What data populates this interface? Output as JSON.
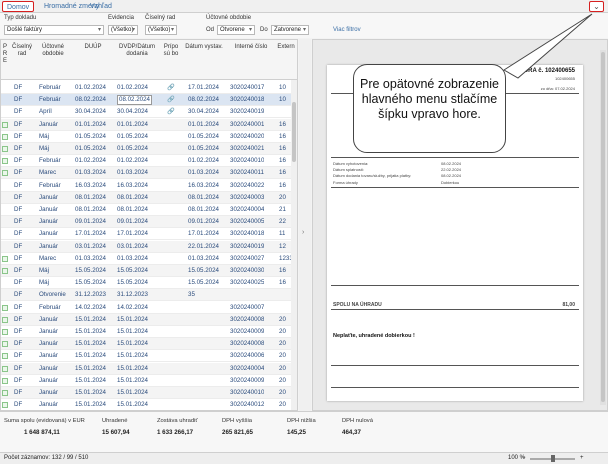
{
  "tabs": [
    "Domov",
    "Hromadné zmeny",
    "Vzhľad"
  ],
  "filters": {
    "typ_label": "Typ dokladu",
    "typ_value": "Došlé faktúry",
    "evidencia_label": "Evidencia",
    "evidencia_value": "(Všetko)",
    "ciselny_label": "Číselný rad",
    "ciselny_value": "(Všetko)",
    "uctovne_label": "Účtovné obdobie",
    "od_label": "Od",
    "od_value": "Otvorene",
    "do_label": "Do",
    "do_value": "Zatvorene",
    "more_link": "Viac filtrov"
  },
  "columns": [
    "P R E",
    "Číselný rad",
    "Účtovné obdobie",
    "DUÚP",
    "DVDP/Dátum dodania",
    "Prípo sú bo",
    "Dátum vystav.",
    "Interné číslo",
    "Extern"
  ],
  "rows": [
    {
      "cr": "DF",
      "ob": "Február",
      "duup": "01.02.2024",
      "dvdp": "01.02.2024",
      "att": "🔗",
      "dv": "17.01.2024",
      "ic": "3020240017",
      "ex": "10",
      "chk": false
    },
    {
      "cr": "DF",
      "ob": "Február",
      "duup": "08.02.2024",
      "dvdp": "08.02.2024",
      "att": "🔗",
      "dv": "08.02.2024",
      "ic": "3020240018",
      "ex": "10",
      "chk": false
    },
    {
      "cr": "DF",
      "ob": "Apríl",
      "duup": "30.04.2024",
      "dvdp": "30.04.2024",
      "att": "🔗",
      "dv": "30.04.2024",
      "ic": "3020240019",
      "ex": "",
      "chk": false
    },
    {
      "cr": "DF",
      "ob": "Január",
      "duup": "01.01.2024",
      "dvdp": "01.01.2024",
      "att": "",
      "dv": "01.01.2024",
      "ic": "3020240001",
      "ex": "16",
      "chk": true
    },
    {
      "cr": "DF",
      "ob": "Máj",
      "duup": "01.05.2024",
      "dvdp": "01.05.2024",
      "att": "",
      "dv": "01.05.2024",
      "ic": "3020240020",
      "ex": "16",
      "chk": true
    },
    {
      "cr": "DF",
      "ob": "Máj",
      "duup": "01.05.2024",
      "dvdp": "01.05.2024",
      "att": "",
      "dv": "01.05.2024",
      "ic": "3020240021",
      "ex": "16",
      "chk": true
    },
    {
      "cr": "DF",
      "ob": "Február",
      "duup": "01.02.2024",
      "dvdp": "01.02.2024",
      "att": "",
      "dv": "01.02.2024",
      "ic": "3020240010",
      "ex": "16",
      "chk": true
    },
    {
      "cr": "DF",
      "ob": "Marec",
      "duup": "01.03.2024",
      "dvdp": "01.03.2024",
      "att": "",
      "dv": "01.03.2024",
      "ic": "3020240011",
      "ex": "16",
      "chk": true
    },
    {
      "cr": "DF",
      "ob": "Február",
      "duup": "16.03.2024",
      "dvdp": "16.03.2024",
      "att": "",
      "dv": "16.03.2024",
      "ic": "3020240022",
      "ex": "16",
      "chk": false
    },
    {
      "cr": "DF",
      "ob": "Január",
      "duup": "08.01.2024",
      "dvdp": "08.01.2024",
      "att": "",
      "dv": "08.01.2024",
      "ic": "3020240003",
      "ex": "20",
      "chk": false
    },
    {
      "cr": "DF",
      "ob": "Január",
      "duup": "08.01.2024",
      "dvdp": "08.01.2024",
      "att": "",
      "dv": "08.01.2024",
      "ic": "3020240004",
      "ex": "21",
      "chk": false
    },
    {
      "cr": "DF",
      "ob": "Január",
      "duup": "09.01.2024",
      "dvdp": "09.01.2024",
      "att": "",
      "dv": "09.01.2024",
      "ic": "3020240005",
      "ex": "22",
      "chk": false
    },
    {
      "cr": "DF",
      "ob": "Január",
      "duup": "17.01.2024",
      "dvdp": "17.01.2024",
      "att": "",
      "dv": "17.01.2024",
      "ic": "3020240018",
      "ex": "11",
      "chk": false
    },
    {
      "cr": "DF",
      "ob": "Január",
      "duup": "03.01.2024",
      "dvdp": "03.01.2024",
      "att": "",
      "dv": "22.01.2024",
      "ic": "3020240019",
      "ex": "12",
      "chk": false
    },
    {
      "cr": "DF",
      "ob": "Marec",
      "duup": "01.03.2024",
      "dvdp": "01.03.2024",
      "att": "",
      "dv": "01.03.2024",
      "ic": "3020240027",
      "ex": "1233",
      "chk": true
    },
    {
      "cr": "DF",
      "ob": "Máj",
      "duup": "15.05.2024",
      "dvdp": "15.05.2024",
      "att": "",
      "dv": "15.05.2024",
      "ic": "3020240030",
      "ex": "16",
      "chk": true
    },
    {
      "cr": "DF",
      "ob": "Máj",
      "duup": "15.05.2024",
      "dvdp": "15.05.2024",
      "att": "",
      "dv": "15.05.2024",
      "ic": "3020240025",
      "ex": "16",
      "chk": false
    },
    {
      "cr": "DF",
      "ob": "Otvorenie",
      "duup": "31.12.2023",
      "dvdp": "31.12.2023",
      "att": "",
      "dv": "35",
      "ic": "",
      "ex": "",
      "chk": false
    },
    {
      "cr": "DF",
      "ob": "Február",
      "duup": "14.02.2024",
      "dvdp": "14.02.2024",
      "att": "",
      "dv": "",
      "ic": "3020240007",
      "ex": "",
      "chk": true
    },
    {
      "cr": "DF",
      "ob": "Január",
      "duup": "15.01.2024",
      "dvdp": "15.01.2024",
      "att": "",
      "dv": "",
      "ic": "3020240008",
      "ex": "20",
      "chk": true
    },
    {
      "cr": "DF",
      "ob": "Január",
      "duup": "15.01.2024",
      "dvdp": "15.01.2024",
      "att": "",
      "dv": "",
      "ic": "3020240009",
      "ex": "20",
      "chk": true
    },
    {
      "cr": "DF",
      "ob": "Január",
      "duup": "15.01.2024",
      "dvdp": "15.01.2024",
      "att": "",
      "dv": "",
      "ic": "3020240008",
      "ex": "20",
      "chk": true
    },
    {
      "cr": "DF",
      "ob": "Január",
      "duup": "15.01.2024",
      "dvdp": "15.01.2024",
      "att": "",
      "dv": "",
      "ic": "3020240006",
      "ex": "20",
      "chk": true
    },
    {
      "cr": "DF",
      "ob": "Január",
      "duup": "15.01.2024",
      "dvdp": "15.01.2024",
      "att": "",
      "dv": "",
      "ic": "3020240004",
      "ex": "20",
      "chk": true
    },
    {
      "cr": "DF",
      "ob": "Január",
      "duup": "15.01.2024",
      "dvdp": "15.01.2024",
      "att": "",
      "dv": "",
      "ic": "3020240009",
      "ex": "20",
      "chk": true
    },
    {
      "cr": "DF",
      "ob": "Január",
      "duup": "15.01.2024",
      "dvdp": "15.01.2024",
      "att": "",
      "dv": "",
      "ic": "3020240010",
      "ex": "20",
      "chk": true
    },
    {
      "cr": "DF",
      "ob": "Január",
      "duup": "15.01.2024",
      "dvdp": "15.01.2024",
      "att": "",
      "dv": "",
      "ic": "3020240012",
      "ex": "20",
      "chk": true
    }
  ],
  "callout": "Pre opätovné zobrazenie hlavného menu stlačíme šípku vpravo hore.",
  "invoice": {
    "title": "FAKTÚRA č. 102400655",
    "number": "102400655",
    "date": "zo dňa: 07.02.2024",
    "dates": [
      {
        "label": "Dátum vyhotovenia:",
        "value": "08.02.2024"
      },
      {
        "label": "Dátum splatnosti:",
        "value": "22.02.2024"
      },
      {
        "label": "Dátum dodania tovaru/služby, prijatia platby:",
        "value": "08.02.2024"
      }
    ],
    "payment_label": "Forma úhrady",
    "payment_value": "Dobierkou",
    "total_label": "SPOLU NA ÚHRADU",
    "total_value": "81,00",
    "note": "Neplaťte, uhradené dobierkou !"
  },
  "summary": {
    "spolu_label": "Suma spolu (evidovaná) v EUR",
    "spolu_value": "1 648 874,11",
    "uhradene_label": "Uhradené",
    "uhradene_value": "15 607,94",
    "zostava_label": "Zostáva uhradiť",
    "zostava_value": "1 633 266,17",
    "dph_vyssia_label": "DPH vyššia",
    "dph_vyssia_value": "265 821,65",
    "dph_nizsia_label": "DPH nižšia",
    "dph_nizsia_value": "145,25",
    "dph_nulova_label": "DPH nulová",
    "dph_nulova_value": "464,37"
  },
  "status": {
    "records": "Počet záznamov: 132 / 99 / 510",
    "zoom": "100 %"
  }
}
